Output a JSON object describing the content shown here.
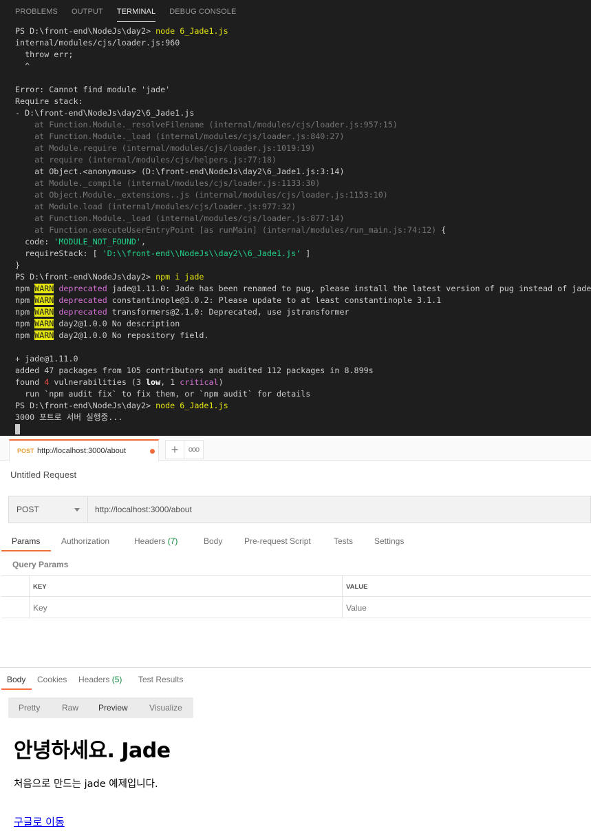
{
  "terminal": {
    "tabs": [
      "PROBLEMS",
      "OUTPUT",
      "TERMINAL",
      "DEBUG CONSOLE"
    ],
    "lines": [
      [
        {
          "t": "PS D:\\front-end\\NodeJs\\day2> "
        },
        {
          "t": "node 6_Jade1.js",
          "c": "yellow"
        }
      ],
      [
        {
          "t": "internal/modules/cjs/loader.js:960"
        }
      ],
      [
        {
          "t": "  throw err;"
        }
      ],
      [
        {
          "t": "  ^"
        }
      ],
      [
        {
          "t": ""
        }
      ],
      [
        {
          "t": "Error: Cannot find module 'jade'"
        }
      ],
      [
        {
          "t": "Require stack:"
        }
      ],
      [
        {
          "t": "- D:\\front-end\\NodeJs\\day2\\6_Jade1.js"
        }
      ],
      [
        {
          "t": "    at Function.Module._resolveFilename (internal/modules/cjs/loader.js:957:15)",
          "c": "dim"
        }
      ],
      [
        {
          "t": "    at Function.Module._load (internal/modules/cjs/loader.js:840:27)",
          "c": "dim"
        }
      ],
      [
        {
          "t": "    at Module.require (internal/modules/cjs/loader.js:1019:19)",
          "c": "dim"
        }
      ],
      [
        {
          "t": "    at require (internal/modules/cjs/helpers.js:77:18)",
          "c": "dim"
        }
      ],
      [
        {
          "t": "    at Object.<anonymous> (D:\\front-end\\NodeJs\\day2\\6_Jade1.js:3:14)"
        }
      ],
      [
        {
          "t": "    at Module._compile (internal/modules/cjs/loader.js:1133:30)",
          "c": "dim"
        }
      ],
      [
        {
          "t": "    at Object.Module._extensions..js (internal/modules/cjs/loader.js:1153:10)",
          "c": "dim"
        }
      ],
      [
        {
          "t": "    at Module.load (internal/modules/cjs/loader.js:977:32)",
          "c": "dim"
        }
      ],
      [
        {
          "t": "    at Function.Module._load (internal/modules/cjs/loader.js:877:14)",
          "c": "dim"
        }
      ],
      [
        {
          "t": "    at Function.executeUserEntryPoint [as runMain] (internal/modules/run_main.js:74:12)",
          "c": "dim"
        },
        {
          "t": " {"
        }
      ],
      [
        {
          "t": "  code: "
        },
        {
          "t": "'MODULE_NOT_FOUND'",
          "c": "green"
        },
        {
          "t": ","
        }
      ],
      [
        {
          "t": "  requireStack: [ "
        },
        {
          "t": "'D:\\\\front-end\\\\NodeJs\\\\day2\\\\6_Jade1.js'",
          "c": "green"
        },
        {
          "t": " ]"
        }
      ],
      [
        {
          "t": "}"
        }
      ],
      [
        {
          "t": "PS D:\\front-end\\NodeJs\\day2> "
        },
        {
          "t": "npm i jade",
          "c": "yellow"
        }
      ],
      [
        {
          "t": "npm "
        },
        {
          "t": "WARN",
          "c": "warn"
        },
        {
          "t": " "
        },
        {
          "t": "deprecated",
          "c": "magenta"
        },
        {
          "t": " jade@1.11.0: Jade has been renamed to pug, please install the latest version of pug instead of jade"
        }
      ],
      [
        {
          "t": "npm "
        },
        {
          "t": "WARN",
          "c": "warn"
        },
        {
          "t": " "
        },
        {
          "t": "deprecated",
          "c": "magenta"
        },
        {
          "t": " constantinople@3.0.2: Please update to at least constantinople 3.1.1"
        }
      ],
      [
        {
          "t": "npm "
        },
        {
          "t": "WARN",
          "c": "warn"
        },
        {
          "t": " "
        },
        {
          "t": "deprecated",
          "c": "magenta"
        },
        {
          "t": " transformers@2.1.0: Deprecated, use jstransformer"
        }
      ],
      [
        {
          "t": "npm "
        },
        {
          "t": "WARN",
          "c": "warn"
        },
        {
          "t": " day2@1.0.0 No description"
        }
      ],
      [
        {
          "t": "npm "
        },
        {
          "t": "WARN",
          "c": "warn"
        },
        {
          "t": " day2@1.0.0 No repository field."
        }
      ],
      [
        {
          "t": ""
        }
      ],
      [
        {
          "t": "+ jade@1.11.0"
        }
      ],
      [
        {
          "t": "added 47 packages from 105 contributors and audited 112 packages in 8.899s"
        }
      ],
      [
        {
          "t": "found "
        },
        {
          "t": "4",
          "c": "red"
        },
        {
          "t": " vulnerabilities (3 "
        },
        {
          "t": "low",
          "c": "bold"
        },
        {
          "t": ", 1 "
        },
        {
          "t": "critical",
          "c": "magenta"
        },
        {
          "t": ")"
        }
      ],
      [
        {
          "t": "  run `npm audit fix` to fix them, or `npm audit` for details"
        }
      ],
      [
        {
          "t": "PS D:\\front-end\\NodeJs\\day2> "
        },
        {
          "t": "node 6_Jade1.js",
          "c": "yellow"
        }
      ],
      [
        {
          "t": "3000 포트로 서버 실행중..."
        }
      ]
    ]
  },
  "postman": {
    "tab": {
      "method": "POST",
      "url": "http://localhost:3000/about"
    },
    "new_tab_label": "+",
    "more_tabs_label": "ooo",
    "request_title": "Untitled Request",
    "method": "POST",
    "url": "http://localhost:3000/about",
    "request_tabs": {
      "params": "Params",
      "authorization": "Authorization",
      "headers": "Headers",
      "headers_count": "(7)",
      "body": "Body",
      "pre_request": "Pre-request Script",
      "tests": "Tests",
      "settings": "Settings"
    },
    "query_params": {
      "title": "Query Params",
      "key_header": "KEY",
      "value_header": "VALUE",
      "key_placeholder": "Key",
      "value_placeholder": "Value"
    },
    "response_tabs": {
      "body": "Body",
      "cookies": "Cookies",
      "headers": "Headers",
      "headers_count": "(5)",
      "test_results": "Test Results"
    },
    "view_modes": [
      "Pretty",
      "Raw",
      "Preview",
      "Visualize"
    ],
    "preview": {
      "heading": "안녕하세요. Jade",
      "paragraph": "처음으로 만드는 jade 예제입니다.",
      "link": "구글로 이동"
    },
    "colors": {
      "accent": "#f26b3a",
      "method_tab": "#e8a33c",
      "count_green": "#0b8a3e"
    }
  }
}
